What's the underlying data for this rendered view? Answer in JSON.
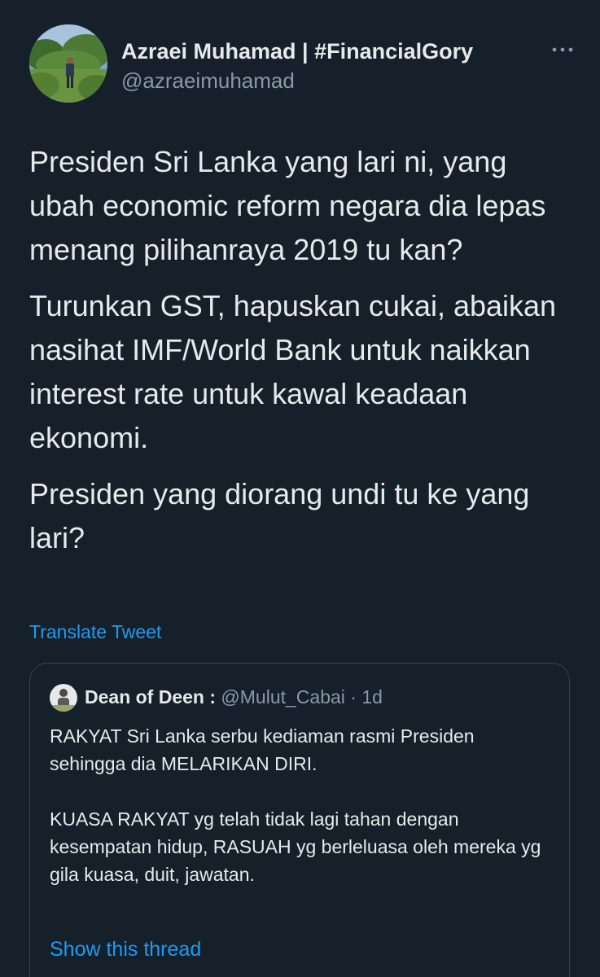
{
  "author": {
    "name": "Azraei Muhamad | #FinancialGory",
    "handle": "@azraeimuhamad",
    "avatar_icon": "profile-photo-man-standing-in-greenery"
  },
  "tweet": {
    "paragraphs": [
      "Presiden Sri Lanka yang lari ni, yang ubah economic reform negara dia lepas menang pilihanraya 2019 tu kan?",
      "Turunkan GST, hapuskan cukai, abaikan nasihat IMF/World Bank untuk naikkan interest rate untuk kawal keadaan ekonomi.",
      "Presiden yang diorang undi tu ke yang lari?"
    ],
    "translate_label": "Translate Tweet",
    "more_icon": "more-options-icon"
  },
  "quote": {
    "name": "Dean of Deen :",
    "handle": "@Mulut_Cabai",
    "separator": "·",
    "time": "1d",
    "paragraphs": [
      "RAKYAT Sri Lanka serbu kediaman rasmi Presiden sehingga dia MELARIKAN DIRI.",
      "KUASA RAKYAT yg telah tidak lagi tahan dengan kesempatan hidup, RASUAH yg berleluasa oleh mereka yg gila kuasa, duit, jawatan."
    ],
    "show_thread_label": "Show this thread"
  },
  "colors": {
    "background": "#15202b",
    "text": "#e7e9ea",
    "secondary_text": "#8b98a5",
    "link": "#1d9bf0",
    "border": "#38444d"
  }
}
